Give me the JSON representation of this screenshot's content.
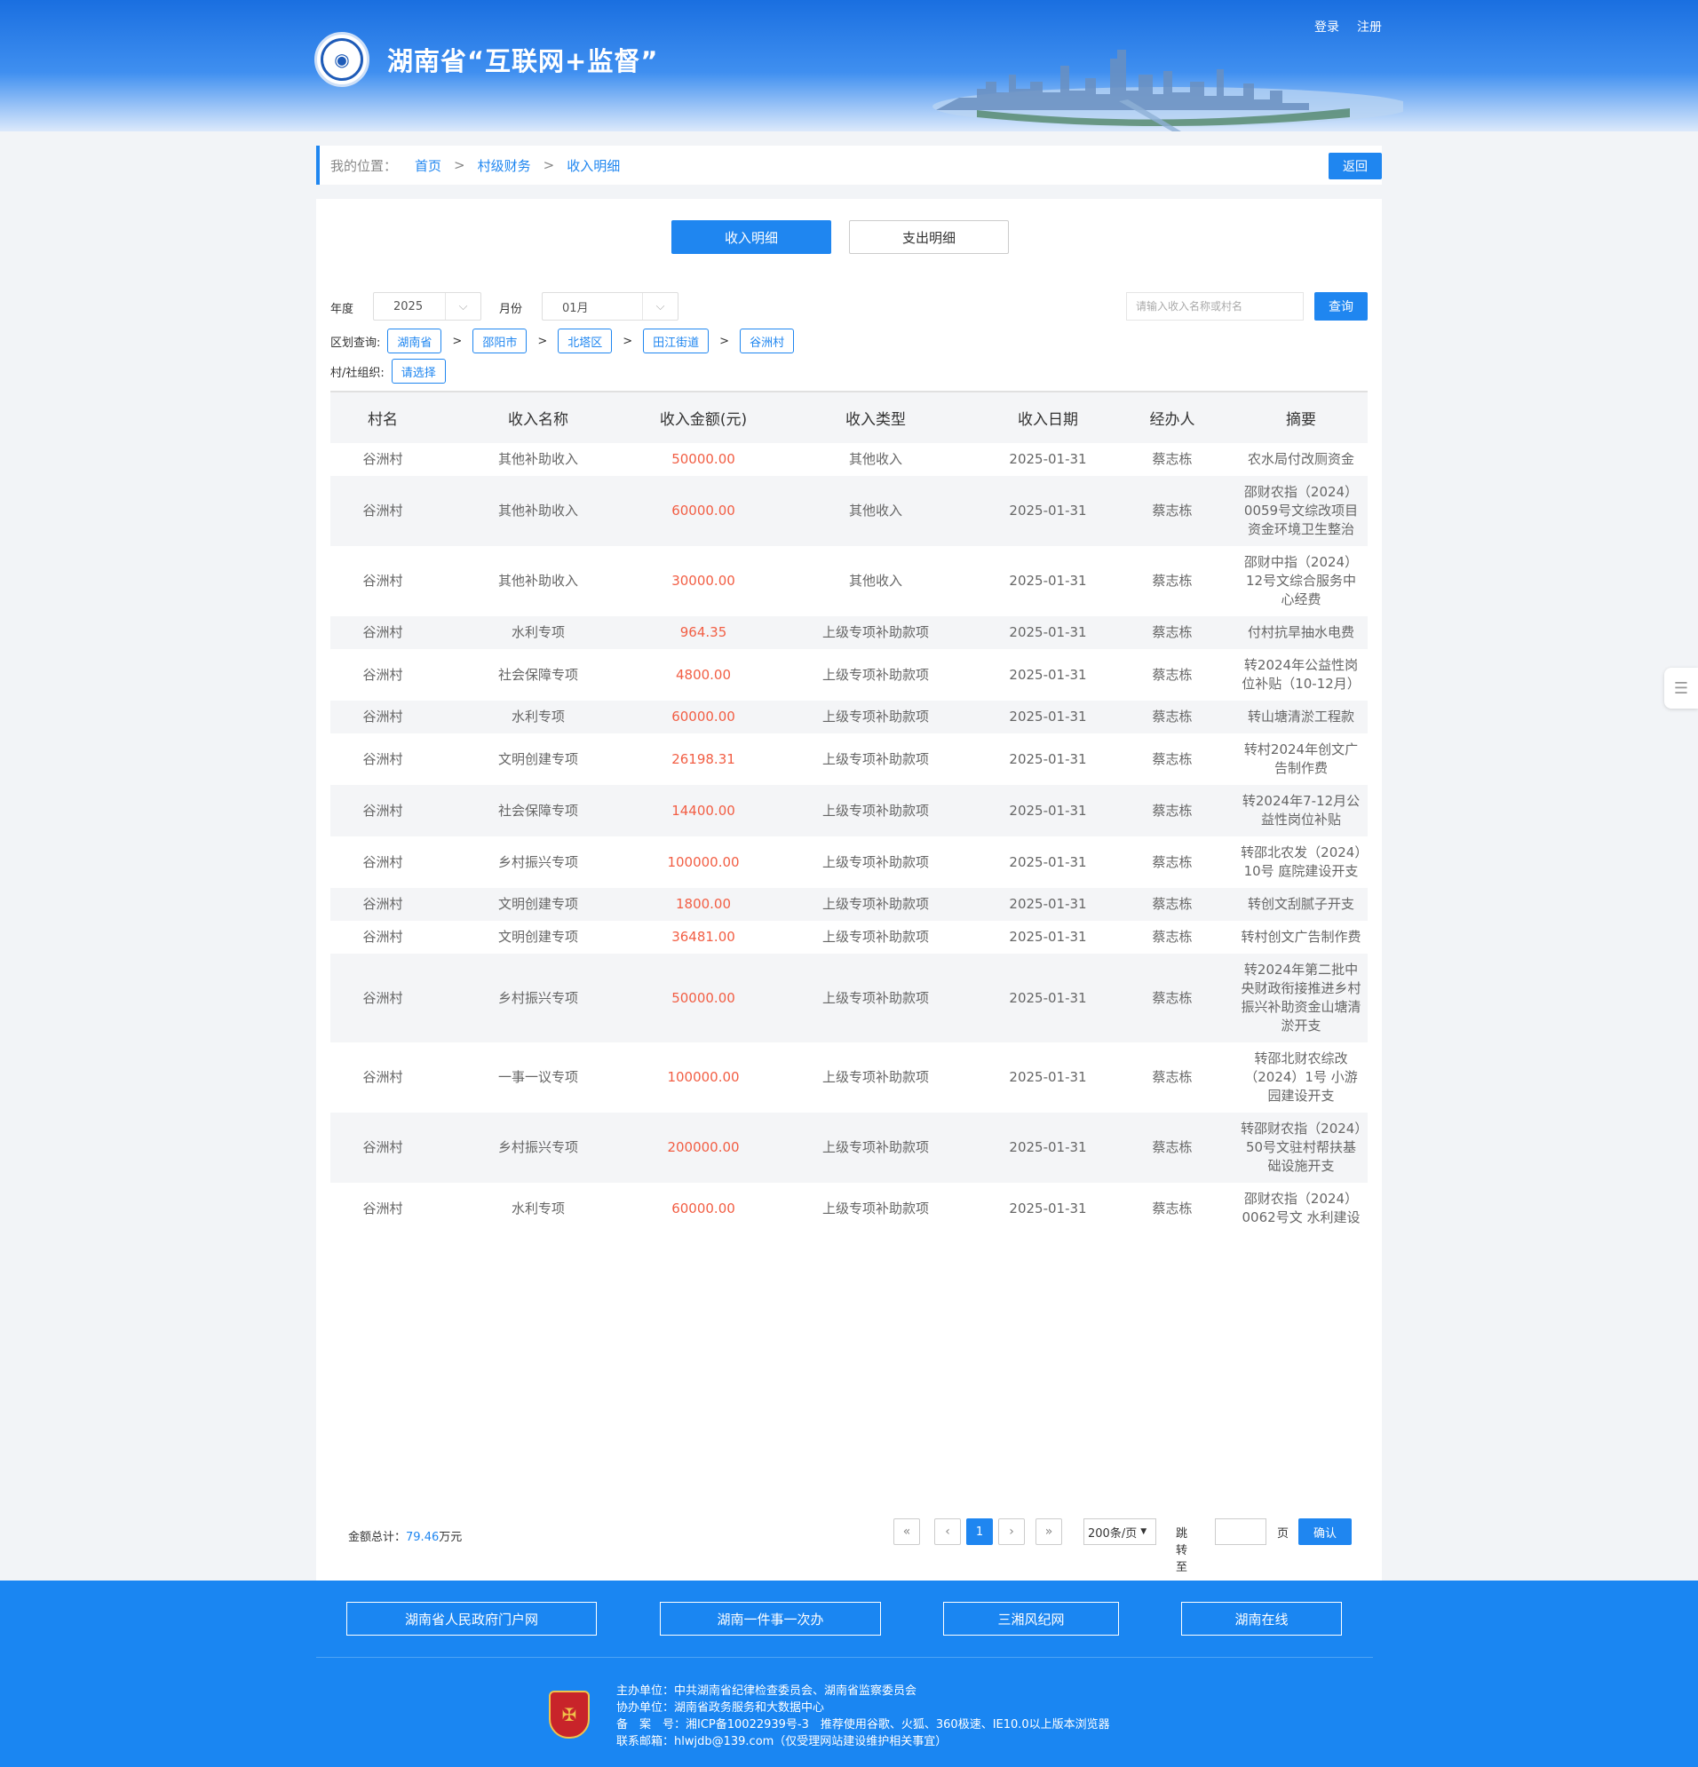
{
  "header": {
    "site_title": "湖南省“互联网+监督”",
    "login": "登录",
    "register": "注册"
  },
  "breadcrumb": {
    "prefix": "我的位置：",
    "items": [
      "首页",
      "村级财务",
      "收入明细"
    ],
    "separator": ">",
    "back": "返回"
  },
  "tabs": [
    {
      "label": "收入明细",
      "active": true
    },
    {
      "label": "支出明细",
      "active": false
    }
  ],
  "filters": {
    "year_label": "年度",
    "year_value": "2025",
    "month_label": "月份",
    "month_value": "01月",
    "search_placeholder": "请输入收入名称或村名",
    "query": "查询",
    "region_label": "区划查询:",
    "region_path": [
      "湖南省",
      "邵阳市",
      "北塔区",
      "田江街道",
      "谷洲村"
    ],
    "org_label": "村/社组织:",
    "org_value": "请选择"
  },
  "table": {
    "headers": [
      "村名",
      "收入名称",
      "收入金额(元)",
      "收入类型",
      "收入日期",
      "经办人",
      "摘要"
    ],
    "rows": [
      [
        "谷洲村",
        "其他补助收入",
        "50000.00",
        "其他收入",
        "2025-01-31",
        "蔡志栋",
        "农水局付改厕资金"
      ],
      [
        "谷洲村",
        "其他补助收入",
        "60000.00",
        "其他收入",
        "2025-01-31",
        "蔡志栋",
        "邵财农指（2024）0059号文综改项目资金环境卫生整治"
      ],
      [
        "谷洲村",
        "其他补助收入",
        "30000.00",
        "其他收入",
        "2025-01-31",
        "蔡志栋",
        "邵财中指（2024）12号文综合服务中心经费"
      ],
      [
        "谷洲村",
        "水利专项",
        "964.35",
        "上级专项补助款项",
        "2025-01-31",
        "蔡志栋",
        "付村抗旱抽水电费"
      ],
      [
        "谷洲村",
        "社会保障专项",
        "4800.00",
        "上级专项补助款项",
        "2025-01-31",
        "蔡志栋",
        "转2024年公益性岗位补贴（10-12月）"
      ],
      [
        "谷洲村",
        "水利专项",
        "60000.00",
        "上级专项补助款项",
        "2025-01-31",
        "蔡志栋",
        "转山塘清淤工程款"
      ],
      [
        "谷洲村",
        "文明创建专项",
        "26198.31",
        "上级专项补助款项",
        "2025-01-31",
        "蔡志栋",
        "转村2024年创文广告制作费"
      ],
      [
        "谷洲村",
        "社会保障专项",
        "14400.00",
        "上级专项补助款项",
        "2025-01-31",
        "蔡志栋",
        "转2024年7-12月公益性岗位补贴"
      ],
      [
        "谷洲村",
        "乡村振兴专项",
        "100000.00",
        "上级专项补助款项",
        "2025-01-31",
        "蔡志栋",
        "转邵北农发（2024）10号 庭院建设开支"
      ],
      [
        "谷洲村",
        "文明创建专项",
        "1800.00",
        "上级专项补助款项",
        "2025-01-31",
        "蔡志栋",
        "转创文刮腻子开支"
      ],
      [
        "谷洲村",
        "文明创建专项",
        "36481.00",
        "上级专项补助款项",
        "2025-01-31",
        "蔡志栋",
        "转村创文广告制作费"
      ],
      [
        "谷洲村",
        "乡村振兴专项",
        "50000.00",
        "上级专项补助款项",
        "2025-01-31",
        "蔡志栋",
        "转2024年第二批中央财政衔接推进乡村振兴补助资金山塘清淤开支"
      ],
      [
        "谷洲村",
        "一事一议专项",
        "100000.00",
        "上级专项补助款项",
        "2025-01-31",
        "蔡志栋",
        "转邵北财农综改（2024）1号 小游园建设开支"
      ],
      [
        "谷洲村",
        "乡村振兴专项",
        "200000.00",
        "上级专项补助款项",
        "2025-01-31",
        "蔡志栋",
        "转邵财农指（2024）50号文驻村帮扶基础设施开支"
      ],
      [
        "谷洲村",
        "水利专项",
        "60000.00",
        "上级专项补助款项",
        "2025-01-31",
        "蔡志栋",
        "邵财农指（2024）0062号文 水利建设"
      ]
    ]
  },
  "summary": {
    "total_label": "金额总计：",
    "total_value": "79.46",
    "total_unit": "万元"
  },
  "pagination": {
    "first": "«",
    "prev": "‹",
    "current": "1",
    "next": "›",
    "last": "»",
    "page_size": "200条/页",
    "jump_label": "跳转至",
    "page_unit": "页",
    "confirm": "确认"
  },
  "footer": {
    "links": [
      "湖南省人民政府门户网",
      "湖南一件事一次办",
      "三湘风纪网",
      "湖南在线"
    ],
    "sponsor": "主办单位：中共湖南省纪律检查委员会、湖南省监察委员会",
    "co_sponsor": "协办单位：湖南省政务服务和大数据中心",
    "icp": "备　案　号：湘ICP备10022939号-3　推荐使用谷歌、火狐、360极速、IE10.0以上版本浏览器",
    "contact": "联系邮箱：hlwjdb@139.com（仅受理网站建设维护相关事宜）"
  },
  "colors": {
    "accent": "#1f86f0",
    "amount": "#f25e44",
    "footer_bg": "#1a86f2"
  }
}
